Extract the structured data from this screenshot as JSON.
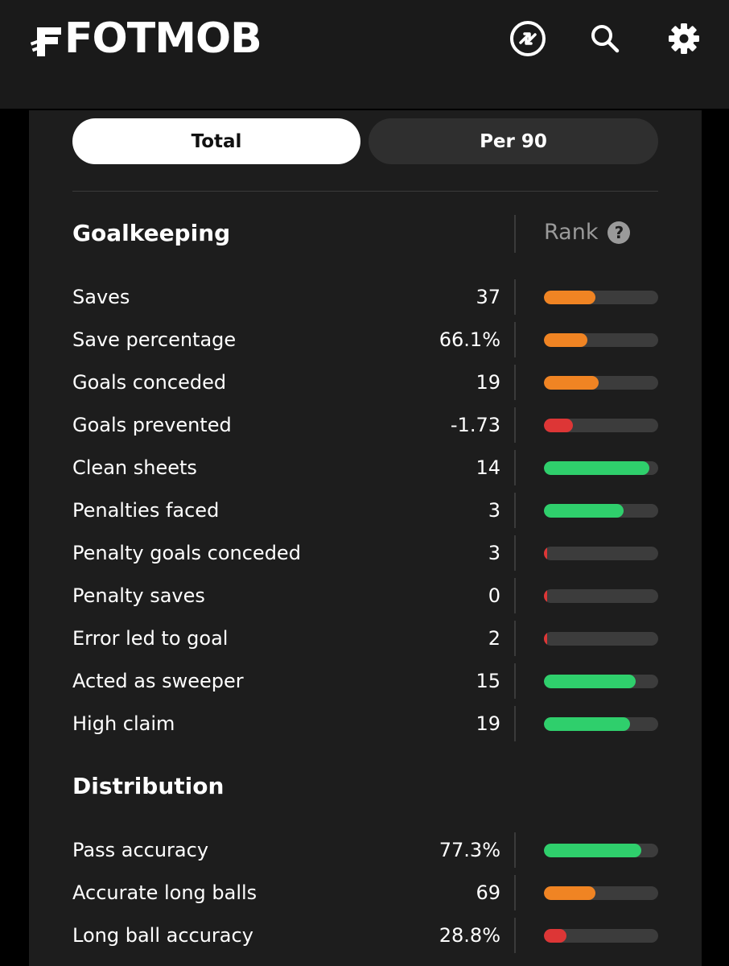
{
  "header": {
    "logo_text": "FOTMOB",
    "icons": [
      "transfer-icon",
      "search-icon",
      "settings-icon"
    ]
  },
  "toggle": {
    "total_label": "Total",
    "per90_label": "Per 90",
    "selected": "Total"
  },
  "colors": {
    "orange": "#f08423",
    "red": "#dd3636",
    "green": "#2fcf6c",
    "track": "#3c3c3c"
  },
  "goalkeeping": {
    "title": "Goalkeeping",
    "rank_label": "Rank",
    "help_symbol": "?",
    "rows": [
      {
        "label": "Saves",
        "value": "37",
        "rank_fraction": 0.45,
        "color": "orange"
      },
      {
        "label": "Save percentage",
        "value": "66.1%",
        "rank_fraction": 0.38,
        "color": "orange"
      },
      {
        "label": "Goals conceded",
        "value": "19",
        "rank_fraction": 0.48,
        "color": "orange"
      },
      {
        "label": "Goals prevented",
        "value": "-1.73",
        "rank_fraction": 0.25,
        "color": "red"
      },
      {
        "label": "Clean sheets",
        "value": "14",
        "rank_fraction": 0.92,
        "color": "green"
      },
      {
        "label": "Penalties faced",
        "value": "3",
        "rank_fraction": 0.7,
        "color": "green"
      },
      {
        "label": "Penalty goals conceded",
        "value": "3",
        "rank_fraction": 0.03,
        "color": "red"
      },
      {
        "label": "Penalty saves",
        "value": "0",
        "rank_fraction": 0.03,
        "color": "red"
      },
      {
        "label": "Error led to goal",
        "value": "2",
        "rank_fraction": 0.03,
        "color": "red"
      },
      {
        "label": "Acted as sweeper",
        "value": "15",
        "rank_fraction": 0.8,
        "color": "green"
      },
      {
        "label": "High claim",
        "value": "19",
        "rank_fraction": 0.75,
        "color": "green"
      }
    ]
  },
  "distribution": {
    "title": "Distribution",
    "rows": [
      {
        "label": "Pass accuracy",
        "value": "77.3%",
        "rank_fraction": 0.85,
        "color": "green"
      },
      {
        "label": "Accurate long balls",
        "value": "69",
        "rank_fraction": 0.45,
        "color": "orange"
      },
      {
        "label": "Long ball accuracy",
        "value": "28.8%",
        "rank_fraction": 0.2,
        "color": "red"
      }
    ]
  }
}
